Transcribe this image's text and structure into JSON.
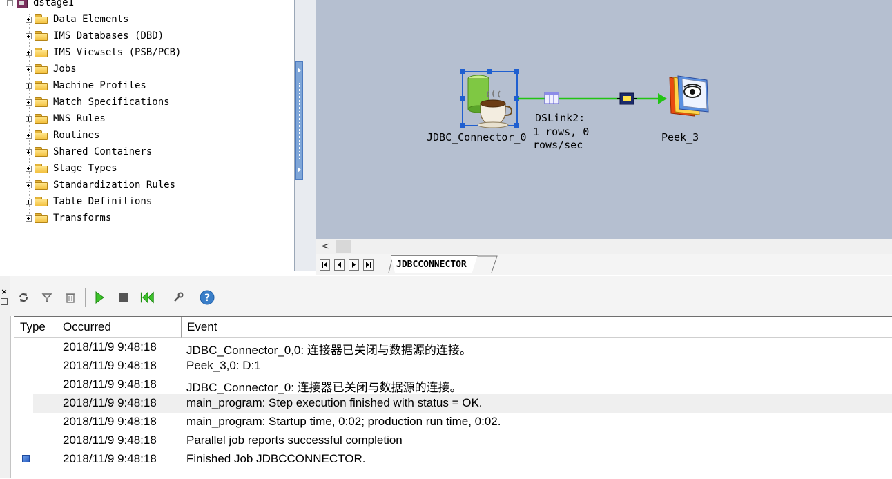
{
  "repository": {
    "root_label": "dstage1",
    "items": [
      {
        "label": "Data Elements"
      },
      {
        "label": "IMS Databases (DBD)"
      },
      {
        "label": "IMS Viewsets (PSB/PCB)"
      },
      {
        "label": "Jobs"
      },
      {
        "label": "Machine Profiles"
      },
      {
        "label": "Match Specifications"
      },
      {
        "label": "MNS Rules"
      },
      {
        "label": "Routines"
      },
      {
        "label": "Shared Containers"
      },
      {
        "label": "Stage Types"
      },
      {
        "label": "Standardization Rules"
      },
      {
        "label": "Table Definitions"
      },
      {
        "label": "Transforms"
      }
    ]
  },
  "canvas": {
    "background": "#b5bfd0",
    "source_stage": {
      "label": "JDBC_Connector_0"
    },
    "target_stage": {
      "label": "Peek_3"
    },
    "link": {
      "name": "DSLink2:",
      "stats_line1": "1 rows, 0",
      "stats_line2": "rows/sec",
      "color": "#22c414"
    },
    "scroll_left_glyph": "<",
    "job_tab": "JDBCCONNECTOR",
    "nav_buttons": [
      "first",
      "previous",
      "next",
      "last"
    ]
  },
  "log": {
    "columns": {
      "type": "Type",
      "occurred": "Occurred",
      "event": "Event"
    },
    "toolbar": [
      "refresh-icon",
      "filter-icon",
      "delete-icon",
      "run-icon",
      "stop-icon",
      "reset-icon",
      "properties-icon",
      "help-icon"
    ],
    "rows": [
      {
        "occurred": "2018/11/9 9:48:18",
        "event": "JDBC_Connector_0,0: 连接器已关闭与数据源的连接。",
        "type_icon": false,
        "selected": false
      },
      {
        "occurred": "2018/11/9 9:48:18",
        "event": "Peek_3,0: D:1",
        "type_icon": false,
        "selected": false
      },
      {
        "occurred": "2018/11/9 9:48:18",
        "event": "JDBC_Connector_0: 连接器已关闭与数据源的连接。",
        "type_icon": false,
        "selected": false
      },
      {
        "occurred": "2018/11/9 9:48:18",
        "event": "main_program: Step execution finished with status = OK.",
        "type_icon": false,
        "selected": true
      },
      {
        "occurred": "2018/11/9 9:48:18",
        "event": "main_program: Startup time, 0:02; production run time, 0:02.",
        "type_icon": false,
        "selected": false
      },
      {
        "occurred": "2018/11/9 9:48:18",
        "event": "Parallel job reports successful completion",
        "type_icon": false,
        "selected": false
      },
      {
        "occurred": "2018/11/9 9:48:18",
        "event": "Finished Job JDBCCONNECTOR.",
        "type_icon": true,
        "selected": false
      }
    ]
  }
}
